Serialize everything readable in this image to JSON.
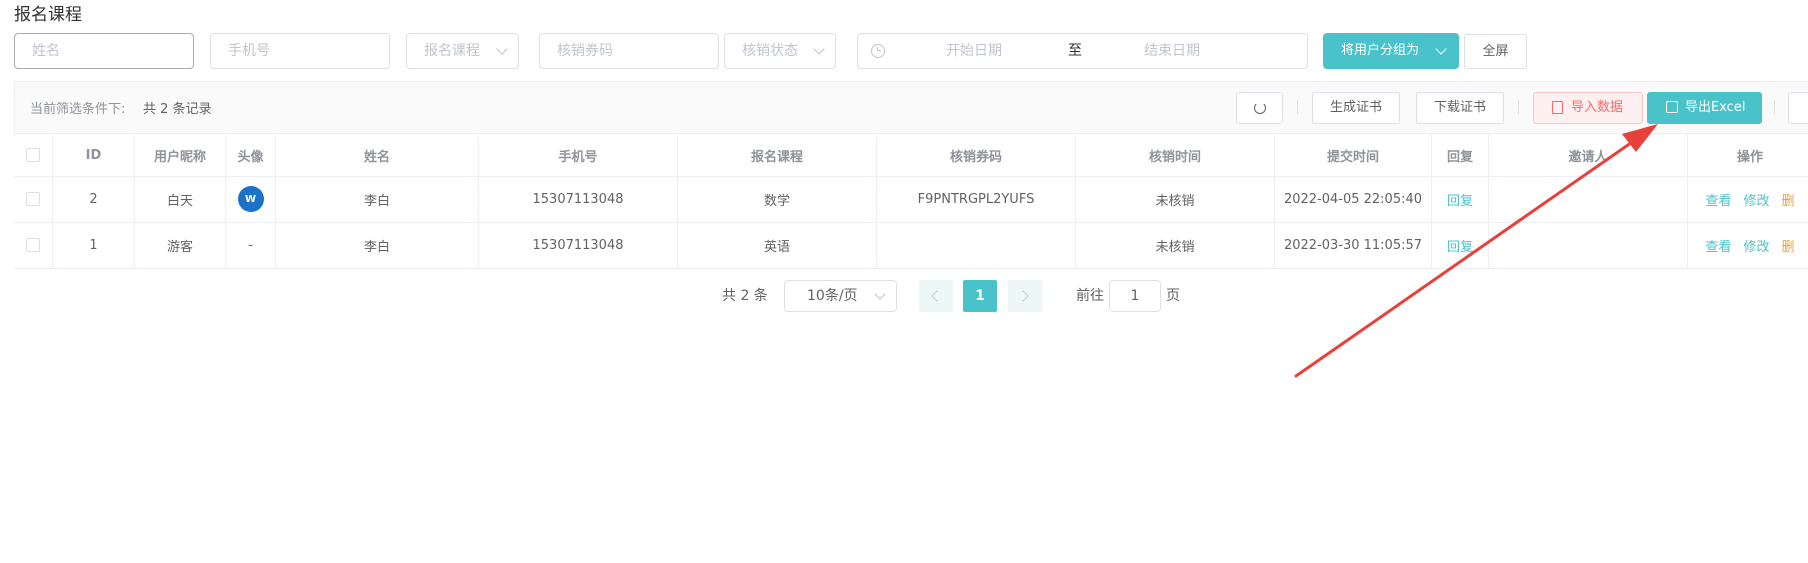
{
  "page": {
    "title": "报名课程"
  },
  "filters": {
    "name_placeholder": "姓名",
    "phone_placeholder": "手机号",
    "course_placeholder": "报名课程",
    "coupon_placeholder": "核销券码",
    "status_placeholder": "核销状态",
    "start_date_placeholder": "开始日期",
    "date_separator": "至",
    "end_date_placeholder": "结束日期",
    "group_button": "将用户分组为",
    "fullscreen_button": "全屏"
  },
  "toolbar": {
    "filter_label": "当前筛选条件下:",
    "record_count": "共 2 条记录",
    "generate_cert": "生成证书",
    "download_cert": "下载证书",
    "import_data": "导入数据",
    "export_excel": "导出Excel"
  },
  "table": {
    "headers": [
      "ID",
      "用户昵称",
      "头像",
      "姓名",
      "手机号",
      "报名课程",
      "核销券码",
      "核销时间",
      "提交时间",
      "回复",
      "邀请人",
      "操作"
    ],
    "rows": [
      {
        "id": "2",
        "nickname": "白天",
        "avatar": "W",
        "name": "李白",
        "phone": "15307113048",
        "course": "数学",
        "coupon": "F9PNTRGPL2YUFS",
        "verify_time": "未核销",
        "submit_time": "2022-04-05 22:05:40",
        "reply": "回复",
        "inviter": "",
        "view": "查看",
        "edit": "修改",
        "delete": "删"
      },
      {
        "id": "1",
        "nickname": "游客",
        "avatar": "-",
        "name": "李白",
        "phone": "15307113048",
        "course": "英语",
        "coupon": "",
        "verify_time": "未核销",
        "submit_time": "2022-03-30 11:05:57",
        "reply": "回复",
        "inviter": "",
        "view": "查看",
        "edit": "修改",
        "delete": "删"
      }
    ]
  },
  "pagination": {
    "total": "共 2 条",
    "page_size": "10条/页",
    "current_page": "1",
    "goto_label": "前往",
    "goto_value": "1",
    "page_suffix": "页"
  },
  "colors": {
    "accent": "#4ac2c9",
    "import_red": "#f56c6c",
    "annotation_arrow": "#e8403a"
  }
}
